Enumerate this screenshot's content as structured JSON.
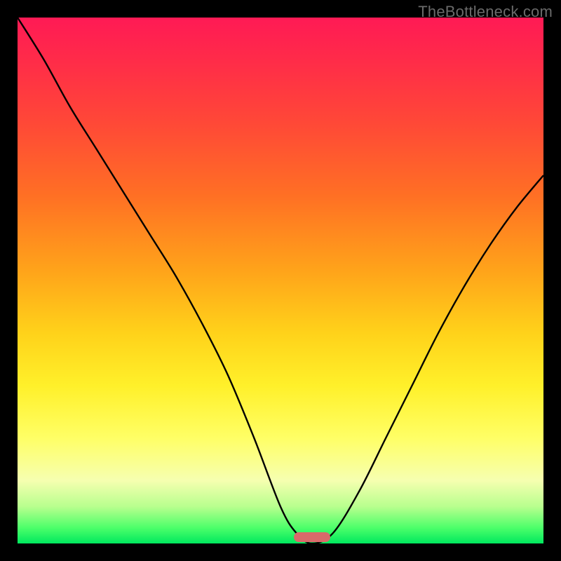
{
  "watermark": "TheBottleneck.com",
  "colors": {
    "frame": "#000000",
    "curve_stroke": "#000000",
    "marker_fill": "#d96a6a"
  },
  "chart_data": {
    "type": "line",
    "title": "",
    "xlabel": "",
    "ylabel": "",
    "xlim": [
      0,
      1
    ],
    "ylim": [
      0,
      1
    ],
    "grid": false,
    "legend": false,
    "annotations": [],
    "series": [
      {
        "name": "bottleneck-curve",
        "x": [
          0.0,
          0.05,
          0.1,
          0.15,
          0.2,
          0.25,
          0.3,
          0.35,
          0.4,
          0.45,
          0.5,
          0.53,
          0.56,
          0.6,
          0.65,
          0.7,
          0.75,
          0.8,
          0.85,
          0.9,
          0.95,
          1.0
        ],
        "values": [
          1.0,
          0.92,
          0.83,
          0.75,
          0.67,
          0.59,
          0.51,
          0.42,
          0.32,
          0.2,
          0.07,
          0.02,
          0.0,
          0.02,
          0.1,
          0.2,
          0.3,
          0.4,
          0.49,
          0.57,
          0.64,
          0.7
        ]
      }
    ],
    "marker": {
      "name": "optimal-range",
      "x_start": 0.525,
      "x_end": 0.595,
      "y": 0.0
    }
  }
}
